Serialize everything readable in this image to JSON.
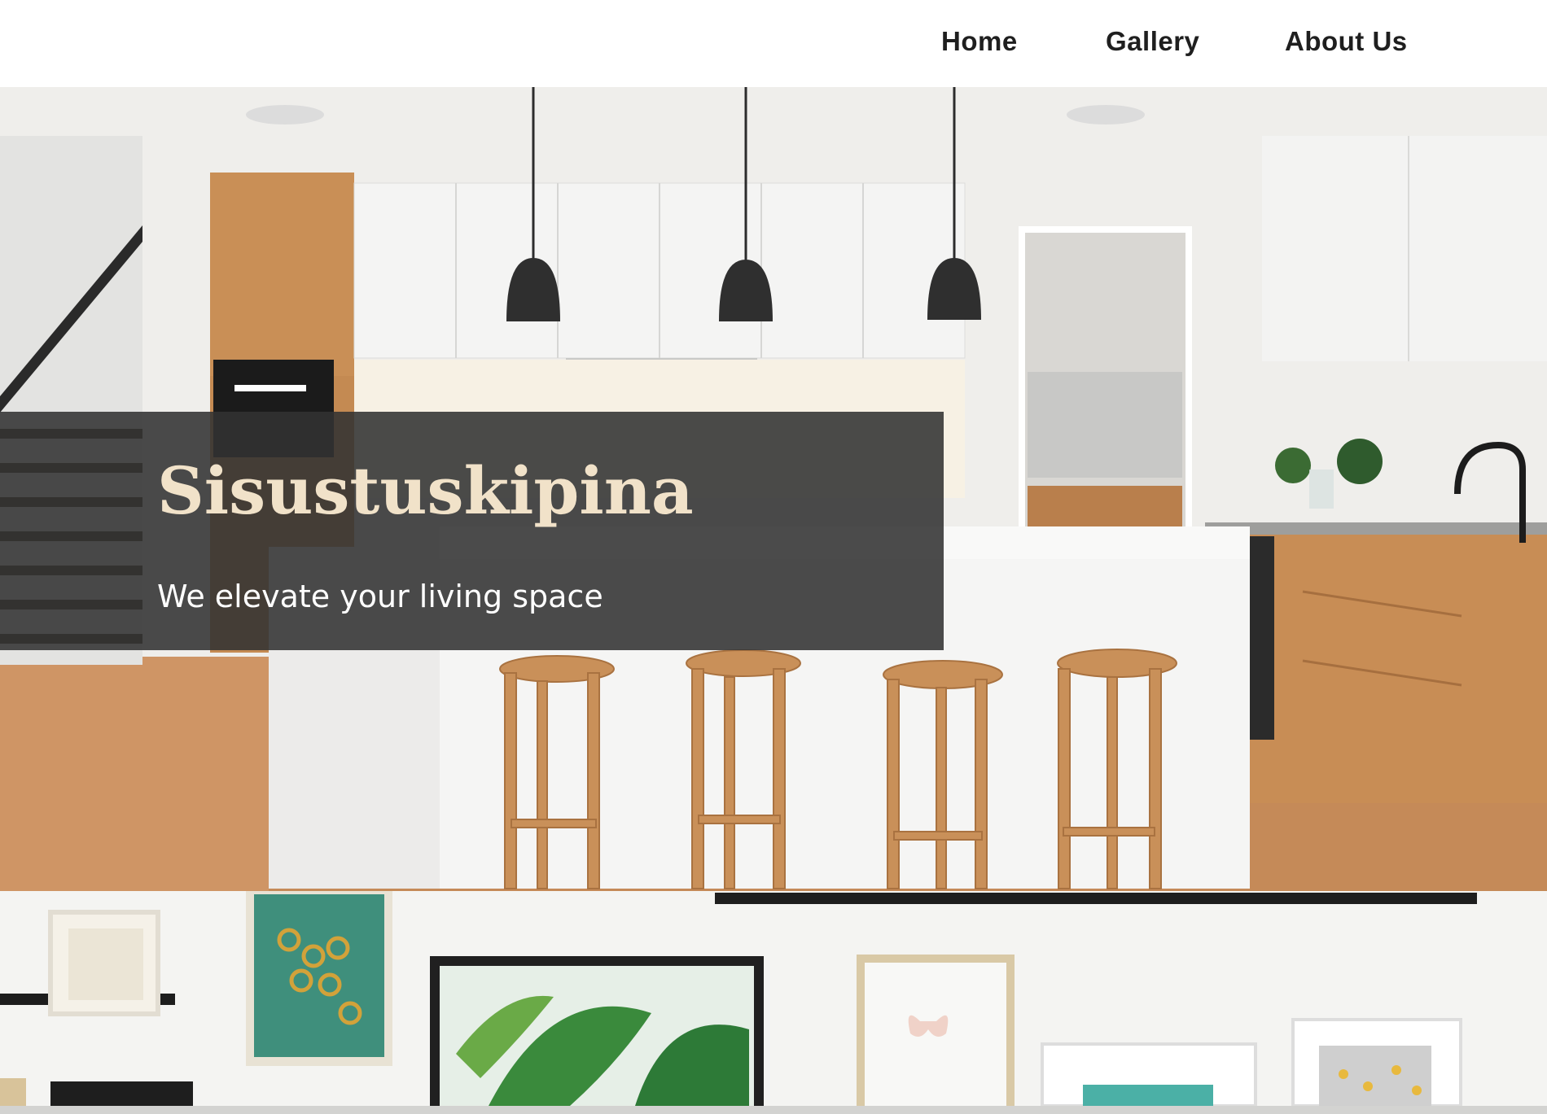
{
  "nav": {
    "home": "Home",
    "gallery": "Gallery",
    "about": "About Us"
  },
  "hero": {
    "title": "Sisustuskipina",
    "subtitle": "We elevate your living space",
    "image": "kitchen-interior-photo"
  },
  "gallery_strip": {
    "image": "framed-art-wall-photo"
  },
  "colors": {
    "header_bg": "#ffffff",
    "nav_text": "#1f1f1f",
    "panel_bg": "#323232",
    "title_text": "#f1e2c9",
    "subtitle_text": "#ffffff"
  }
}
